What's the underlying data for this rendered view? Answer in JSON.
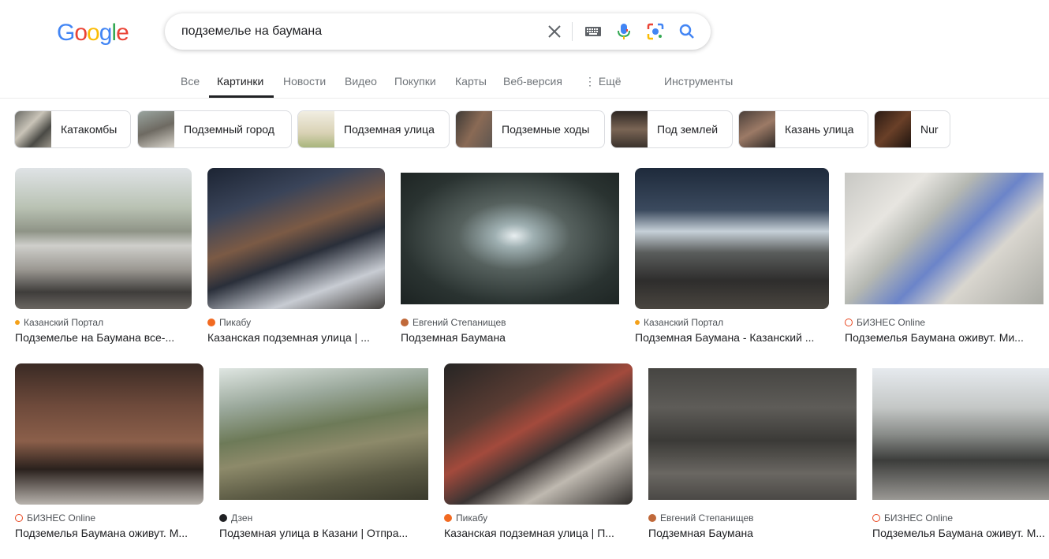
{
  "logo": {
    "letters": [
      "G",
      "o",
      "o",
      "g",
      "l",
      "e"
    ],
    "colors": [
      "#4285f4",
      "#ea4335",
      "#fbbc05",
      "#4285f4",
      "#34a853",
      "#ea4335"
    ]
  },
  "search": {
    "query": "подземелье на баумана"
  },
  "icons": {
    "clear": "close-icon",
    "keyboard": "keyboard-icon",
    "voice": "microphone-icon",
    "lens": "camera-lens-icon",
    "search": "search-icon"
  },
  "tabs": [
    {
      "label": "Все"
    },
    {
      "label": "Картинки",
      "active": true
    },
    {
      "label": "Новости"
    },
    {
      "label": "Видео"
    },
    {
      "label": "Покупки"
    },
    {
      "label": "Карты"
    },
    {
      "label": "Веб-версия"
    },
    {
      "label": "⋮ Ещё"
    },
    {
      "label": "Инструменты"
    }
  ],
  "chips": [
    {
      "label": "Катакомбы"
    },
    {
      "label": "Подземный город"
    },
    {
      "label": "Подземная улица"
    },
    {
      "label": "Подземные ходы"
    },
    {
      "label": "Под землей"
    },
    {
      "label": "Казань улица"
    },
    {
      "label": "Nur"
    }
  ],
  "results": [
    {
      "source": "Казанский Портал",
      "title": "Подземелье на Баумана все-...",
      "fav_color": "#f4a11a"
    },
    {
      "source": "Пикабу",
      "title": "Казанская подземная улица | ...",
      "fav_color": "#f26a21"
    },
    {
      "source": "Евгений Степанищев",
      "title": "Подземная Баумана",
      "fav_color": "#c0693a"
    },
    {
      "source": "Казанский Портал",
      "title": "Подземная Баумана - Казанский ...",
      "fav_color": "#f4a11a"
    },
    {
      "source": "БИЗНЕС Online",
      "title": "Подземелья Баумана оживут. Ми...",
      "fav_color": "#e8451e"
    },
    {
      "source": "БИЗНЕС Online",
      "title": "Подземелья Баумана оживут. М...",
      "fav_color": "#e8451e"
    },
    {
      "source": "Дзен",
      "title": "Подземная улица в Казани | Отпра...",
      "fav_color": "#202124"
    },
    {
      "source": "Пикабу",
      "title": "Казанская подземная улица | П...",
      "fav_color": "#f26a21"
    },
    {
      "source": "Евгений Степанищев",
      "title": "Подземная Баумана",
      "fav_color": "#c0693a"
    },
    {
      "source": "БИЗНЕС Online",
      "title": "Подземелья Баумана оживут. М...",
      "fav_color": "#e8451e"
    }
  ]
}
